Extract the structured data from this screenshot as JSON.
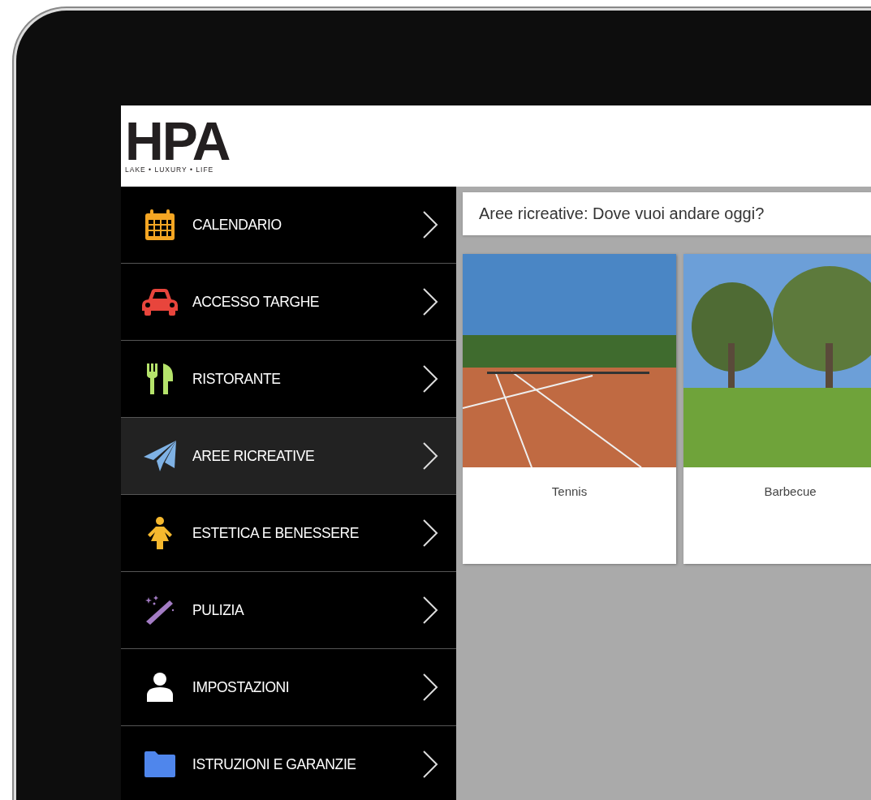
{
  "logo": {
    "mark": "HPA",
    "tagline": "LAKE • LUXURY • LIFE"
  },
  "menu": [
    {
      "label": "CALENDARIO",
      "kind": "calendar",
      "color": "#f5a623",
      "selected": false
    },
    {
      "label": "ACCESSO TARGHE",
      "kind": "car",
      "color": "#e8453c",
      "selected": false
    },
    {
      "label": "RISTORANTE",
      "kind": "cutlery",
      "color": "#b5e36b",
      "selected": false
    },
    {
      "label": "AREE RICREATIVE",
      "kind": "plane",
      "color": "#7fb2e5",
      "selected": true
    },
    {
      "label": "ESTETICA E BENESSERE",
      "kind": "person",
      "color": "#f5b82e",
      "selected": false
    },
    {
      "label": "PULIZIA",
      "kind": "wand",
      "color": "#a37cc4",
      "selected": false
    },
    {
      "label": "IMPOSTAZIONI",
      "kind": "user",
      "color": "#ffffff",
      "selected": false
    },
    {
      "label": "ISTRUZIONI E GARANZIE",
      "kind": "folder",
      "color": "#4f86ec",
      "selected": false
    }
  ],
  "heading": "Aree ricreative: Dove vuoi andare oggi?",
  "cards": [
    {
      "label": "Tennis",
      "kind": "tennis"
    },
    {
      "label": "Barbecue",
      "kind": "garden"
    }
  ]
}
